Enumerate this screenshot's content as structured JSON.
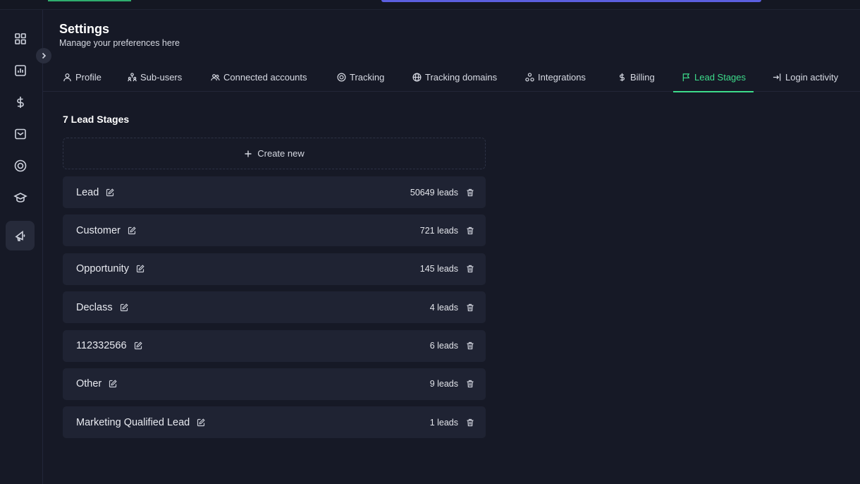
{
  "header": {
    "title": "Settings",
    "subtitle": "Manage your preferences here"
  },
  "sidebar": {
    "items": [
      {
        "icon": "dashboard-grid-icon"
      },
      {
        "icon": "bar-chart-icon"
      },
      {
        "icon": "dollar-icon"
      },
      {
        "icon": "inbox-icon"
      },
      {
        "icon": "target-icon"
      },
      {
        "icon": "graduation-cap-icon"
      },
      {
        "icon": "megaphone-icon",
        "active": true
      }
    ],
    "collapse_icon": "chevron-right-icon"
  },
  "tabs": [
    {
      "label": "Profile",
      "icon": "user-icon"
    },
    {
      "label": "Sub-users",
      "icon": "sub-users-icon"
    },
    {
      "label": "Connected accounts",
      "icon": "users-icon"
    },
    {
      "label": "Tracking",
      "icon": "target-icon"
    },
    {
      "label": "Tracking domains",
      "icon": "globe-icon"
    },
    {
      "label": "Integrations",
      "icon": "integrations-icon"
    },
    {
      "label": "Billing",
      "icon": "dollar-icon"
    },
    {
      "label": "Lead Stages",
      "icon": "flag-icon",
      "active": true
    },
    {
      "label": "Login activity",
      "icon": "login-icon"
    }
  ],
  "lead_stages": {
    "title": "7 Lead Stages",
    "create_label": "Create new",
    "stages": [
      {
        "name": "Lead",
        "count": "50649 leads"
      },
      {
        "name": "Customer",
        "count": "721 leads"
      },
      {
        "name": "Opportunity",
        "count": "145 leads"
      },
      {
        "name": "Declass",
        "count": "4 leads"
      },
      {
        "name": "112332566",
        "count": "6 leads"
      },
      {
        "name": "Other",
        "count": "9 leads"
      },
      {
        "name": "Marketing Qualified Lead",
        "count": "1 leads"
      }
    ]
  },
  "colors": {
    "accent": "#3ddc8b",
    "background": "#161926",
    "row_background": "#1f2333",
    "topbar_indicator": "#5b5fe0"
  }
}
